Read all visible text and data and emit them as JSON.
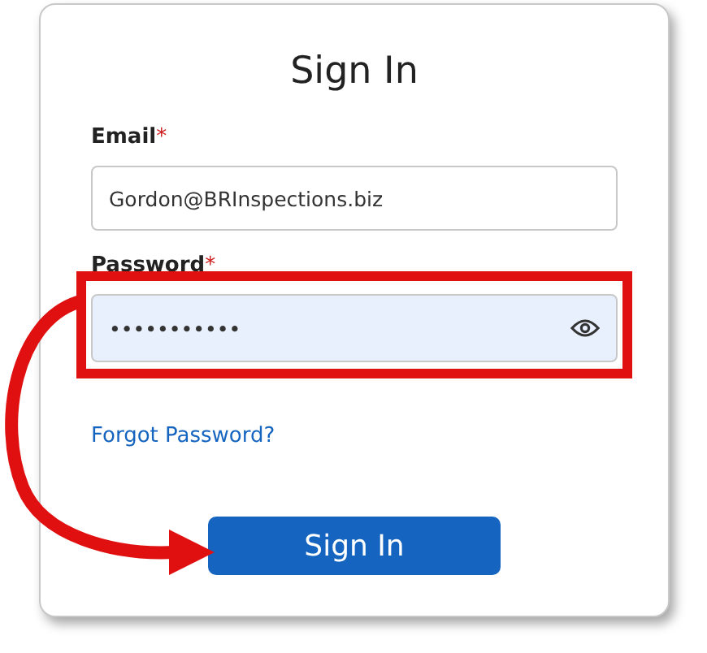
{
  "title": "Sign In",
  "fields": [
    {
      "label": "Email",
      "required_mark": "*",
      "value": "Gordon@BRInspections.biz",
      "kind": "text",
      "highlighted": false
    },
    {
      "label": "Password",
      "required_mark": "*",
      "value": "•••••••••••",
      "kind": "password",
      "highlighted": true
    }
  ],
  "forgot_link": "Forgot Password?",
  "submit_button": "Sign In"
}
